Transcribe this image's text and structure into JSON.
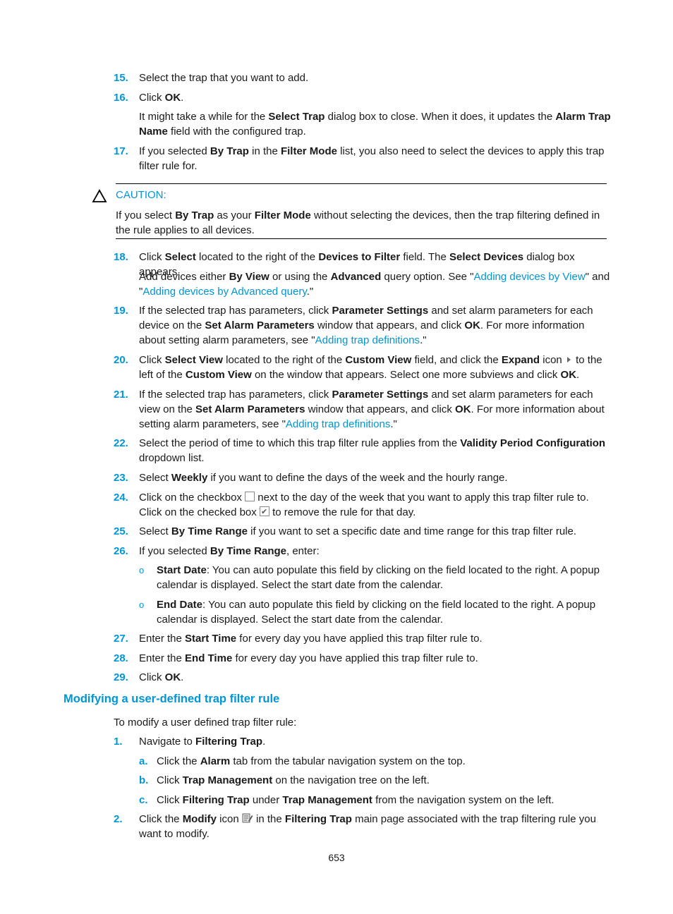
{
  "steps_top": [
    {
      "num": "15.",
      "parts": [
        {
          "t": "Select the trap that you want to add."
        }
      ]
    },
    {
      "num": "16.",
      "parts": [
        {
          "t": "Click "
        },
        {
          "b": "OK"
        },
        {
          "t": "."
        }
      ]
    },
    {
      "num": "17.",
      "parts": [
        {
          "t": "If you selected "
        },
        {
          "b": "By Trap"
        },
        {
          "t": " in the "
        },
        {
          "b": "Filter Mode"
        },
        {
          "t": " list, you also need to select the devices to apply this trap filter rule for."
        }
      ]
    }
  ],
  "step16_note": [
    {
      "t": "It might take a while for the "
    },
    {
      "b": "Select Trap"
    },
    {
      "t": " dialog box to close. When it does, it updates the "
    },
    {
      "b": "Alarm Trap Name"
    },
    {
      "t": " field with the configured trap."
    }
  ],
  "caution": {
    "label": "CAUTION:",
    "icon": "warning-triangle-icon",
    "text": [
      {
        "t": "If you select "
      },
      {
        "b": "By Trap"
      },
      {
        "t": " as your "
      },
      {
        "b": "Filter Mode"
      },
      {
        "t": " without selecting the devices, then the trap filtering defined in the rule applies to all devices."
      }
    ]
  },
  "steps_mid": [
    {
      "num": "18.",
      "parts": [
        {
          "t": "Click "
        },
        {
          "b": "Select"
        },
        {
          "t": " located to the right of the "
        },
        {
          "b": "Devices to Filter"
        },
        {
          "t": " field. The "
        },
        {
          "b": "Select Devices"
        },
        {
          "t": " dialog box appears."
        }
      ]
    },
    {
      "num": "19.",
      "parts": [
        {
          "t": "If the selected trap has parameters, click "
        },
        {
          "b": "Parameter Settings"
        },
        {
          "t": " and set alarm parameters for each device on the "
        },
        {
          "b": "Set Alarm Parameters"
        },
        {
          "t": " window that appears, and click "
        },
        {
          "b": "OK"
        },
        {
          "t": ". For more information about setting alarm parameters, see \""
        },
        {
          "a": "Adding trap definitions"
        },
        {
          "t": ".\""
        }
      ]
    },
    {
      "num": "20.",
      "parts": [
        {
          "t": "Click "
        },
        {
          "b": "Select View"
        },
        {
          "t": " located to the right of the "
        },
        {
          "b": "Custom View"
        },
        {
          "t": " field, and click the "
        },
        {
          "b": "Expand"
        },
        {
          "t": " icon "
        },
        {
          "icon": "expand"
        },
        {
          "t": " to the left of the "
        },
        {
          "b": "Custom View"
        },
        {
          "t": " on the window that appears. Select one more subviews and click "
        },
        {
          "b": "OK"
        },
        {
          "t": "."
        }
      ]
    },
    {
      "num": "21.",
      "parts": [
        {
          "t": "If the selected trap has parameters, click "
        },
        {
          "b": "Parameter Settings"
        },
        {
          "t": " and set alarm parameters for each view on the "
        },
        {
          "b": "Set Alarm Parameters"
        },
        {
          "t": " window that appears, and click "
        },
        {
          "b": "OK"
        },
        {
          "t": ". For more information about setting alarm parameters, see \""
        },
        {
          "a": "Adding trap definitions"
        },
        {
          "t": ".\""
        }
      ]
    },
    {
      "num": "22.",
      "parts": [
        {
          "t": "Select the period of time to which this trap filter rule applies from the "
        },
        {
          "b": "Validity Period Configuration"
        },
        {
          "t": " dropdown list."
        }
      ]
    },
    {
      "num": "23.",
      "parts": [
        {
          "t": "Select "
        },
        {
          "b": "Weekly"
        },
        {
          "t": " if you want to define the days of the week and the hourly range."
        }
      ]
    },
    {
      "num": "24.",
      "parts": [
        {
          "t": "Click on the checkbox "
        },
        {
          "icon": "checkbox"
        },
        {
          "t": " next to the day of the week that you want to apply this trap filter rule to. Click on the checked box "
        },
        {
          "icon": "checkbox-checked"
        },
        {
          "t": " to remove the rule for that day."
        }
      ]
    },
    {
      "num": "25.",
      "parts": [
        {
          "t": "Select "
        },
        {
          "b": "By Time Range"
        },
        {
          "t": " if you want to set a specific date and time range for this trap filter rule."
        }
      ]
    },
    {
      "num": "26.",
      "parts": [
        {
          "t": "If you selected "
        },
        {
          "b": "By Time Range"
        },
        {
          "t": ", enter:"
        }
      ]
    }
  ],
  "step18_note": [
    {
      "t": "Add devices either "
    },
    {
      "b": "By View"
    },
    {
      "t": " or using the "
    },
    {
      "b": "Advanced"
    },
    {
      "t": " query option. See \""
    },
    {
      "a": "Adding devices by View"
    },
    {
      "t": "\" and \""
    },
    {
      "a": "Adding devices by Advanced query"
    },
    {
      "t": ".\""
    }
  ],
  "step26_bullets": [
    {
      "bullet": "o",
      "parts": [
        {
          "b": "Start Date"
        },
        {
          "t": ": You can auto populate this field by clicking on the field located to the right. A popup calendar is displayed. Select the start date from the calendar."
        }
      ]
    },
    {
      "bullet": "o",
      "parts": [
        {
          "b": "End Date"
        },
        {
          "t": ": You can auto populate this field by clicking on the field located to the right. A popup calendar is displayed. Select the start date from the calendar."
        }
      ]
    }
  ],
  "steps_end": [
    {
      "num": "27.",
      "parts": [
        {
          "t": "Enter the "
        },
        {
          "b": "Start Time"
        },
        {
          "t": " for every day you have applied this trap filter rule to."
        }
      ]
    },
    {
      "num": "28.",
      "parts": [
        {
          "t": "Enter the "
        },
        {
          "b": "End Time"
        },
        {
          "t": " for every day you have applied this trap filter rule to."
        }
      ]
    },
    {
      "num": "29.",
      "parts": [
        {
          "t": "Click "
        },
        {
          "b": "OK"
        },
        {
          "t": "."
        }
      ]
    }
  ],
  "section": {
    "heading": "Modifying a user-defined trap filter rule",
    "intro": "To modify a user defined trap filter rule:",
    "steps": [
      {
        "num": "1.",
        "parts": [
          {
            "t": "Navigate to "
          },
          {
            "b": "Filtering Trap"
          },
          {
            "t": "."
          }
        ]
      },
      {
        "num": "2.",
        "parts": [
          {
            "t": "Click the "
          },
          {
            "b": "Modify"
          },
          {
            "t": " icon "
          },
          {
            "icon": "modify"
          },
          {
            "t": " in the "
          },
          {
            "b": "Filtering Trap"
          },
          {
            "t": " main page associated with the trap filtering rule you want to modify."
          }
        ]
      }
    ],
    "substeps": [
      {
        "num": "a.",
        "parts": [
          {
            "t": "Click the "
          },
          {
            "b": "Alarm"
          },
          {
            "t": " tab from the tabular navigation system on the top."
          }
        ]
      },
      {
        "num": "b.",
        "parts": [
          {
            "t": "Click "
          },
          {
            "b": "Trap Management"
          },
          {
            "t": " on the navigation tree on the left."
          }
        ]
      },
      {
        "num": "c.",
        "parts": [
          {
            "t": "Click "
          },
          {
            "b": "Filtering Trap"
          },
          {
            "t": " under "
          },
          {
            "b": "Trap Management"
          },
          {
            "t": " from the navigation system on the left."
          }
        ]
      }
    ]
  },
  "page_number": "653",
  "colors": {
    "accent": "#0096d6",
    "text": "#1a1a1a"
  }
}
